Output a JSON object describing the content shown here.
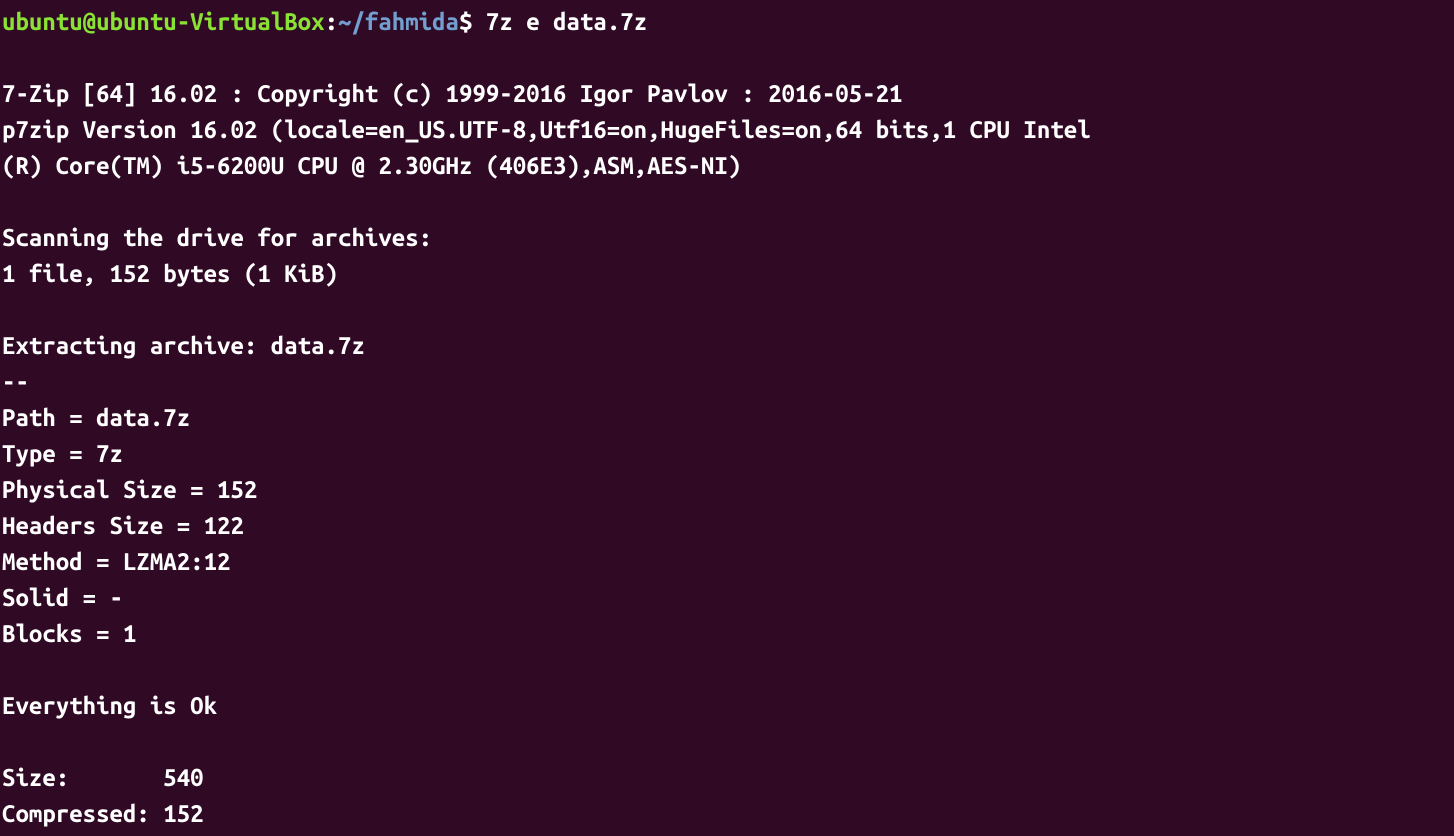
{
  "prompt": {
    "user_host": "ubuntu@ubuntu-VirtualBox",
    "separator": ":",
    "path_tilde": "~",
    "path_dir": "/fahmida",
    "dollar": "$",
    "command": " 7z e data.7z"
  },
  "output": {
    "blank1": "",
    "zip_header": "7-Zip [64] 16.02 : Copyright (c) 1999-2016 Igor Pavlov : 2016-05-21",
    "p7zip_line1": "p7zip Version 16.02 (locale=en_US.UTF-8,Utf16=on,HugeFiles=on,64 bits,1 CPU Intel",
    "p7zip_line2": "(R) Core(TM) i5-6200U CPU @ 2.30GHz (406E3),ASM,AES-NI)",
    "blank2": "",
    "scanning": "Scanning the drive for archives:",
    "file_info": "1 file, 152 bytes (1 KiB)",
    "blank3": "",
    "extracting": "Extracting archive: data.7z",
    "dashes": "--",
    "path": "Path = data.7z",
    "type": "Type = 7z",
    "physical_size": "Physical Size = 152",
    "headers_size": "Headers Size = 122",
    "method": "Method = LZMA2:12",
    "solid": "Solid = -",
    "blocks": "Blocks = 1",
    "blank4": "",
    "everything_ok": "Everything is Ok",
    "blank5": "",
    "size": "Size:       540",
    "compressed": "Compressed: 152"
  }
}
